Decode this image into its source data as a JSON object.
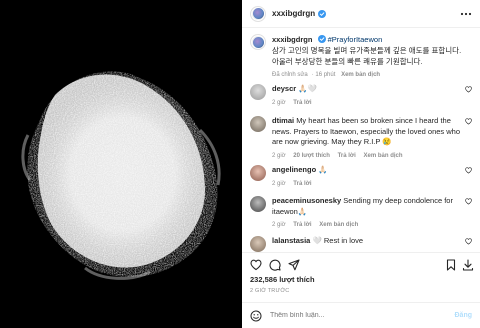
{
  "post": {
    "author": "xxxibgdrgn"
  },
  "caption": {
    "author": "xxxibgdrgn",
    "hashtag": "#PrayforItaewon",
    "line1": "삼가 고인의 명복을 빌며 유가족분들께 깊은 애도를 표합니다.",
    "line2": "아울러 부상당한 분들의 빠른 쾌유를 기원합니다.",
    "edited": "Đã chỉnh sửa",
    "age": "16 phút",
    "translate": "Xem bản dịch"
  },
  "comments": [
    {
      "user": "deyscr",
      "text": "🙏🏻🤍",
      "age": "2 giờ",
      "reply": "Trả lời"
    },
    {
      "user": "dtimai",
      "text": "My heart has been so broken since I heard the news. Prayers to Itaewon, especially the loved ones who are now grieving. May they R.I.P 😢",
      "age": "2 giờ",
      "likes": "20 lượt thích",
      "reply": "Trả lời",
      "translate": "Xem bản dịch"
    },
    {
      "user": "angelinengo",
      "text": "🙏🏻",
      "age": "2 giờ",
      "reply": "Trả lời"
    },
    {
      "user": "peaceminusonesky",
      "text": "Sending my deep condolence for itaewon🙏🏻",
      "age": "2 giờ",
      "reply": "Trả lời",
      "translate": "Xem bản dịch"
    },
    {
      "user": "lalanstasia",
      "text": "🤍 Rest in love"
    }
  ],
  "engagement": {
    "likes": "232,586 lượt thích",
    "time": "2 GIỜ TRƯỚC"
  },
  "composer": {
    "placeholder": "Thêm bình luận...",
    "post_label": "Đăng"
  },
  "icons": [
    "more-icon",
    "verified-icon",
    "heart-icon",
    "comment-icon",
    "share-icon",
    "bookmark-icon",
    "emoji-icon"
  ]
}
